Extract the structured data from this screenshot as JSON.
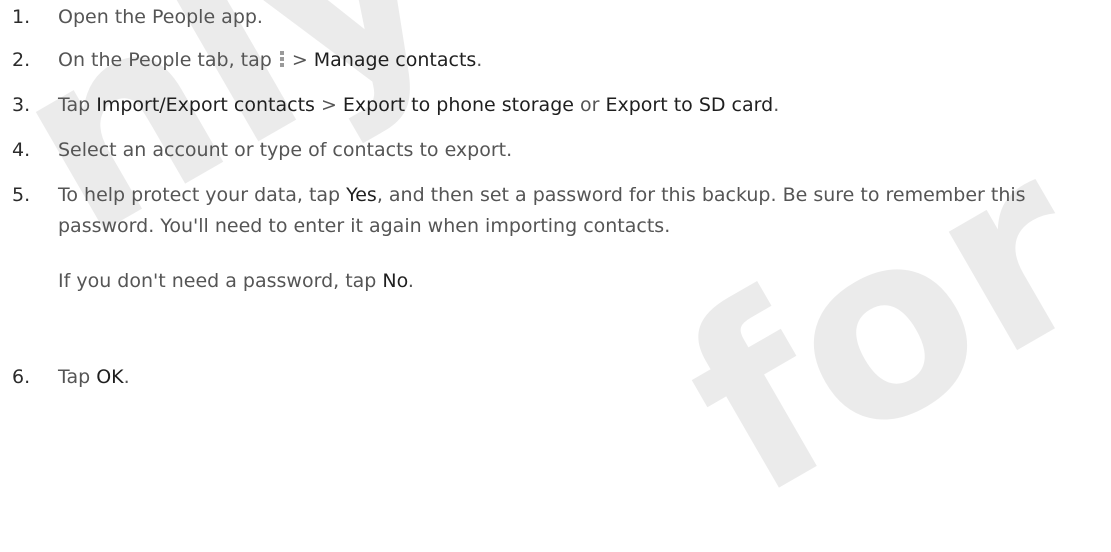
{
  "steps": [
    {
      "number": "1.",
      "parts": [
        "Open the People app."
      ]
    },
    {
      "number": "2.",
      "parts": [
        "On the People tab, tap",
        "> ",
        "Manage contacts",
        "."
      ]
    },
    {
      "number": "3.",
      "parts": [
        "Tap ",
        "Import/Export contacts",
        " > ",
        "Export to phone storage",
        " or ",
        "Export to SD card",
        "."
      ]
    },
    {
      "number": "4.",
      "parts": [
        "Select an account or type of contacts to export."
      ]
    },
    {
      "number": "5.",
      "parts": [
        "To help protect your data, tap ",
        "Yes",
        ", and then set a password for this backup. Be sure to remember this password. You'll need to enter it again when importing contacts."
      ],
      "note_parts": [
        "If you don't need a password, tap ",
        "No",
        "."
      ]
    },
    {
      "number": "6.",
      "parts": [
        "Tap ",
        "OK",
        "."
      ]
    }
  ],
  "icons": {
    "menu": "menu-dots-icon"
  },
  "watermark": {
    "line1": "nly fo",
    "line2": "for certif"
  }
}
